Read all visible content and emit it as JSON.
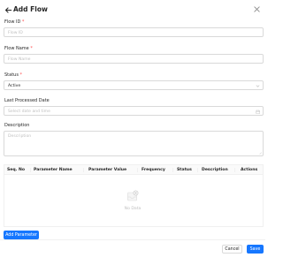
{
  "header": {
    "title": "Add Flow"
  },
  "form": {
    "flow_id": {
      "label": "Flow ID",
      "required_mark": "*",
      "placeholder": "Flow ID"
    },
    "flow_name": {
      "label": "Flow Name",
      "required_mark": "*",
      "placeholder": "Flow Name"
    },
    "status": {
      "label": "Status",
      "required_mark": "*",
      "value": "Active"
    },
    "last_processed_date": {
      "label": "Last Processed Date",
      "placeholder": "Select date and time"
    },
    "description": {
      "label": "Description",
      "placeholder": "Description"
    }
  },
  "table": {
    "columns": [
      "Seq. No",
      "Parameter Name",
      "Parameter Value",
      "Frequency",
      "Status",
      "Description",
      "Actions"
    ],
    "empty_text": "No Data"
  },
  "buttons": {
    "add_parameter": "Add Parameter",
    "cancel": "Cancel",
    "save": "Save"
  },
  "colors": {
    "primary": "#1677ff",
    "required": "#ff4d4f",
    "border": "#d9d9d9"
  },
  "icons": {
    "back": "arrow-left-icon",
    "close": "close-icon",
    "select": "chevron-down-icon",
    "date": "calendar-icon",
    "empty": "empty-inbox-icon"
  }
}
